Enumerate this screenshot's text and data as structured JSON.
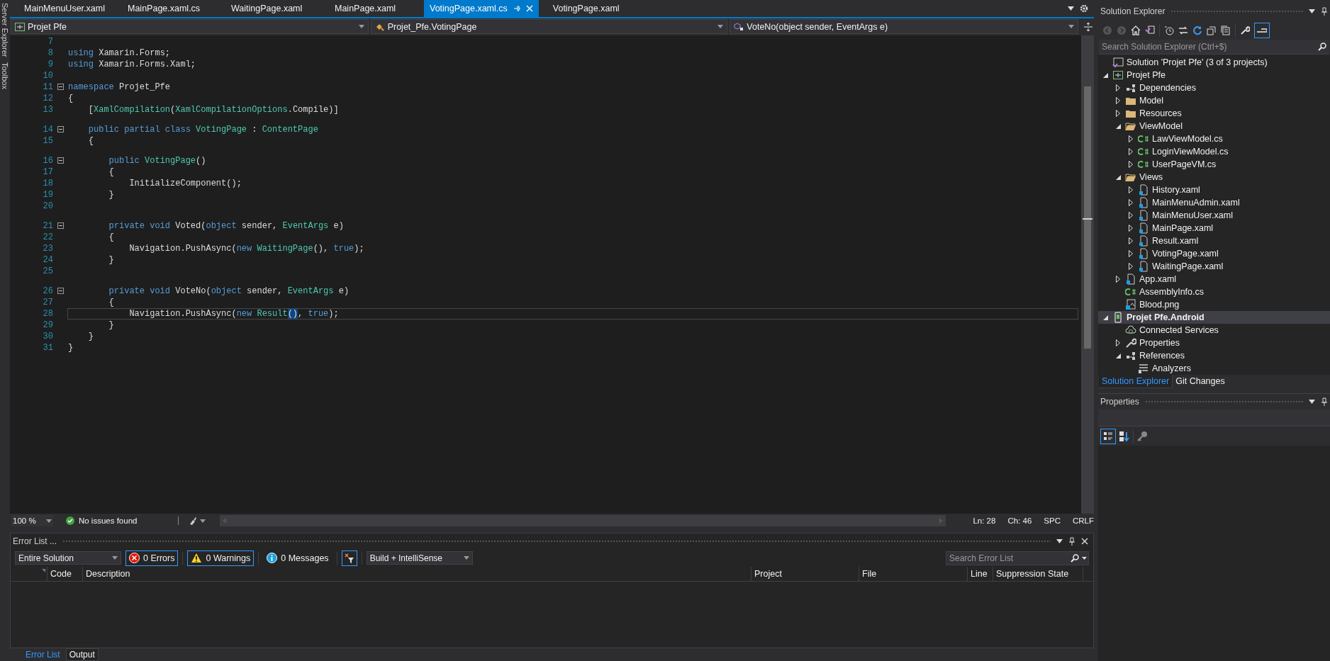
{
  "left_strip": [
    "Server Explorer",
    "Toolbox"
  ],
  "tabs": [
    {
      "label": "MainMenuUser.xaml",
      "selected": false
    },
    {
      "label": "MainPage.xaml.cs",
      "selected": false
    },
    {
      "label": "WaitingPage.xaml",
      "selected": false
    },
    {
      "label": "MainPage.xaml",
      "selected": false
    },
    {
      "label": "VotingPage.xaml.cs",
      "selected": true
    },
    {
      "label": "VotingPage.xaml",
      "selected": false
    }
  ],
  "nav_bar": {
    "project": "Projet Pfe",
    "type": "Projet_Pfe.VotingPage",
    "member": "VoteNo(object sender, EventArgs e)"
  },
  "code_lines": [
    {
      "n": "7",
      "fold": false,
      "gap": false,
      "current": false
    },
    {
      "n": "8",
      "fold": false,
      "gap": false,
      "current": false,
      "segs": [
        {
          "kind": "keyword",
          "t": "using"
        },
        {
          "kind": "plain",
          "t": " Xamarin.Forms;"
        }
      ]
    },
    {
      "n": "9",
      "fold": false,
      "gap": false,
      "current": false,
      "segs": [
        {
          "kind": "keyword",
          "t": "using"
        },
        {
          "kind": "plain",
          "t": " Xamarin.Forms.Xaml;"
        }
      ]
    },
    {
      "n": "10",
      "fold": false,
      "gap": false,
      "current": false
    },
    {
      "n": "11",
      "fold": true,
      "gap": false,
      "current": false,
      "segs": [
        {
          "kind": "keyword",
          "t": "namespace"
        },
        {
          "kind": "plain",
          "t": " Projet_Pfe"
        }
      ]
    },
    {
      "n": "12",
      "fold": false,
      "gap": false,
      "current": false,
      "segs": [
        {
          "kind": "plain",
          "t": "{"
        }
      ]
    },
    {
      "n": "13",
      "fold": false,
      "gap": false,
      "current": false,
      "segs": [
        {
          "kind": "plain",
          "t": "    ["
        },
        {
          "kind": "type",
          "t": "XamlCompilation"
        },
        {
          "kind": "plain",
          "t": "("
        },
        {
          "kind": "type",
          "t": "XamlCompilationOptions"
        },
        {
          "kind": "plain",
          "t": ".Compile)]"
        }
      ]
    },
    {
      "n": "14",
      "fold": true,
      "gap": true,
      "current": false,
      "segs": [
        {
          "kind": "keyword",
          "t": "    public partial class"
        },
        {
          "kind": "type",
          "t": " VotingPage"
        },
        {
          "kind": "plain",
          "t": " : "
        },
        {
          "kind": "type",
          "t": "ContentPage"
        }
      ]
    },
    {
      "n": "15",
      "fold": false,
      "gap": false,
      "current": false,
      "segs": [
        {
          "kind": "plain",
          "t": "    {"
        }
      ]
    },
    {
      "n": "16",
      "fold": true,
      "gap": true,
      "current": false,
      "segs": [
        {
          "kind": "keyword",
          "t": "        public"
        },
        {
          "kind": "type",
          "t": " VotingPage"
        },
        {
          "kind": "plain",
          "t": "()"
        }
      ]
    },
    {
      "n": "17",
      "fold": false,
      "gap": false,
      "current": false,
      "segs": [
        {
          "kind": "plain",
          "t": "        {"
        }
      ]
    },
    {
      "n": "18",
      "fold": false,
      "gap": false,
      "current": false,
      "segs": [
        {
          "kind": "plain",
          "t": "            InitializeComponent();"
        }
      ]
    },
    {
      "n": "19",
      "fold": false,
      "gap": false,
      "current": false,
      "segs": [
        {
          "kind": "plain",
          "t": "        }"
        }
      ]
    },
    {
      "n": "20",
      "fold": false,
      "gap": false,
      "current": false
    },
    {
      "n": "21",
      "fold": true,
      "gap": true,
      "current": false,
      "segs": [
        {
          "kind": "keyword",
          "t": "        private void"
        },
        {
          "kind": "plain",
          "t": " Voted("
        },
        {
          "kind": "keyword",
          "t": "object"
        },
        {
          "kind": "plain",
          "t": " sender, "
        },
        {
          "kind": "type",
          "t": "EventArgs"
        },
        {
          "kind": "plain",
          "t": " e)"
        }
      ]
    },
    {
      "n": "22",
      "fold": false,
      "gap": false,
      "current": false,
      "segs": [
        {
          "kind": "plain",
          "t": "        {"
        }
      ]
    },
    {
      "n": "23",
      "fold": false,
      "gap": false,
      "current": false,
      "segs": [
        {
          "kind": "plain",
          "t": "            Navigation.PushAsync("
        },
        {
          "kind": "keyword",
          "t": "new"
        },
        {
          "kind": "type",
          "t": " WaitingPage"
        },
        {
          "kind": "plain",
          "t": "(), "
        },
        {
          "kind": "keyword",
          "t": "true"
        },
        {
          "kind": "plain",
          "t": ");"
        }
      ]
    },
    {
      "n": "24",
      "fold": false,
      "gap": false,
      "current": false,
      "segs": [
        {
          "kind": "plain",
          "t": "        }"
        }
      ]
    },
    {
      "n": "25",
      "fold": false,
      "gap": false,
      "current": false
    },
    {
      "n": "26",
      "fold": true,
      "gap": true,
      "current": false,
      "segs": [
        {
          "kind": "keyword",
          "t": "        private void"
        },
        {
          "kind": "plain",
          "t": " VoteNo("
        },
        {
          "kind": "keyword",
          "t": "object"
        },
        {
          "kind": "plain",
          "t": " sender, "
        },
        {
          "kind": "type",
          "t": "EventArgs"
        },
        {
          "kind": "plain",
          "t": " e)"
        }
      ]
    },
    {
      "n": "27",
      "fold": false,
      "gap": false,
      "current": false,
      "segs": [
        {
          "kind": "plain",
          "t": "        {"
        }
      ]
    },
    {
      "n": "28",
      "fold": false,
      "gap": false,
      "current": true,
      "segs": [
        {
          "kind": "plain",
          "t": "            Navigation.PushAsync("
        },
        {
          "kind": "keyword",
          "t": "new"
        },
        {
          "kind": "type",
          "t": " Result"
        },
        {
          "kind": "match",
          "t": "()"
        },
        {
          "kind": "plain",
          "t": ", "
        },
        {
          "kind": "keyword",
          "t": "true"
        },
        {
          "kind": "plain",
          "t": ");"
        }
      ]
    },
    {
      "n": "29",
      "fold": false,
      "gap": false,
      "current": false,
      "segs": [
        {
          "kind": "plain",
          "t": "        }"
        }
      ]
    },
    {
      "n": "30",
      "fold": false,
      "gap": false,
      "current": false,
      "segs": [
        {
          "kind": "plain",
          "t": "    }"
        }
      ]
    },
    {
      "n": "31",
      "fold": false,
      "gap": false,
      "current": false,
      "segs": [
        {
          "kind": "plain",
          "t": "}"
        }
      ]
    }
  ],
  "editor_status": {
    "zoom": "100 %",
    "issues": "No issues found",
    "line": "Ln: 28",
    "column": "Ch: 46",
    "whitespace": "SPC",
    "line_endings": "CRLF"
  },
  "error_list": {
    "title": "Error List ...",
    "scope": "Entire Solution",
    "filters": [
      {
        "kind": "error",
        "label": "0 Errors",
        "selected": true
      },
      {
        "kind": "warning",
        "label": "0 Warnings",
        "selected": true
      },
      {
        "kind": "info",
        "label": "0 Messages",
        "selected": false
      }
    ],
    "source": "Build + IntelliSense",
    "search_placeholder": "Search Error List",
    "columns": [
      "Code",
      "Description",
      "Project",
      "File",
      "Line",
      "Suppression State"
    ]
  },
  "bottom_tabs": [
    {
      "label": "Error List",
      "selected": true
    },
    {
      "label": "Output",
      "selected": false
    }
  ],
  "solution_explorer": {
    "title": "Solution Explorer",
    "search_placeholder": "Search Solution Explorer (Ctrl+$)",
    "tree": [
      {
        "label": "Solution 'Projet Pfe' (3 of 3 projects)",
        "kind": "solution",
        "expandable": false,
        "expanded": false,
        "selected": false,
        "startup": false
      },
      {
        "label": "Projet Pfe",
        "kind": "csproj",
        "expandable": true,
        "expanded": true,
        "selected": false,
        "startup": false,
        "children": [
          {
            "label": "Dependencies",
            "kind": "deps",
            "expandable": true,
            "expanded": false,
            "selected": false,
            "startup": false
          },
          {
            "label": "Model",
            "kind": "folder",
            "expandable": true,
            "expanded": false,
            "selected": false,
            "startup": false
          },
          {
            "label": "Resources",
            "kind": "folder",
            "expandable": true,
            "expanded": false,
            "selected": false,
            "startup": false
          },
          {
            "label": "ViewModel",
            "kind": "open-folder",
            "expandable": true,
            "expanded": true,
            "selected": false,
            "startup": false,
            "children": [
              {
                "label": "LawViewModel.cs",
                "kind": "cs",
                "expandable": true,
                "expanded": false,
                "selected": false,
                "startup": false
              },
              {
                "label": "LoginViewModel.cs",
                "kind": "cs",
                "expandable": true,
                "expanded": false,
                "selected": false,
                "startup": false
              },
              {
                "label": "UserPageVM.cs",
                "kind": "cs",
                "expandable": true,
                "expanded": false,
                "selected": false,
                "startup": false
              }
            ]
          },
          {
            "label": "Views",
            "kind": "open-folder",
            "expandable": true,
            "expanded": true,
            "selected": false,
            "startup": false,
            "children": [
              {
                "label": "History.xaml",
                "kind": "xaml",
                "expandable": true,
                "expanded": false,
                "selected": false,
                "startup": false
              },
              {
                "label": "MainMenuAdmin.xaml",
                "kind": "xaml",
                "expandable": true,
                "expanded": false,
                "selected": false,
                "startup": false
              },
              {
                "label": "MainMenuUser.xaml",
                "kind": "xaml",
                "expandable": true,
                "expanded": false,
                "selected": false,
                "startup": false
              },
              {
                "label": "MainPage.xaml",
                "kind": "xaml",
                "expandable": true,
                "expanded": false,
                "selected": false,
                "startup": false
              },
              {
                "label": "Result.xaml",
                "kind": "xaml",
                "expandable": true,
                "expanded": false,
                "selected": false,
                "startup": false
              },
              {
                "label": "VotingPage.xaml",
                "kind": "xaml",
                "expandable": true,
                "expanded": false,
                "selected": false,
                "startup": false
              },
              {
                "label": "WaitingPage.xaml",
                "kind": "xaml",
                "expandable": true,
                "expanded": false,
                "selected": false,
                "startup": false
              }
            ]
          },
          {
            "label": "App.xaml",
            "kind": "xaml",
            "expandable": true,
            "expanded": false,
            "selected": false,
            "startup": false
          },
          {
            "label": "AssemblyInfo.cs",
            "kind": "cs",
            "expandable": false,
            "expanded": false,
            "selected": false,
            "startup": false
          },
          {
            "label": "Blood.png",
            "kind": "image",
            "expandable": false,
            "expanded": false,
            "selected": false,
            "startup": false
          }
        ]
      },
      {
        "label": "Projet Pfe.Android",
        "kind": "android",
        "expandable": true,
        "expanded": true,
        "selected": true,
        "startup": true,
        "children": [
          {
            "label": "Connected Services",
            "kind": "service",
            "expandable": false,
            "expanded": false,
            "selected": false,
            "startup": false
          },
          {
            "label": "Properties",
            "kind": "properties",
            "expandable": true,
            "expanded": false,
            "selected": false,
            "startup": false
          },
          {
            "label": "References",
            "kind": "deps",
            "expandable": true,
            "expanded": true,
            "selected": false,
            "startup": false,
            "children": [
              {
                "label": "Analyzers",
                "kind": "analyzer",
                "expandable": false,
                "expanded": false,
                "selected": false,
                "startup": false
              }
            ]
          }
        ]
      }
    ],
    "tabs": [
      {
        "label": "Solution Explorer",
        "selected": true
      },
      {
        "label": "Git Changes",
        "selected": false
      }
    ]
  },
  "properties": {
    "title": "Properties"
  }
}
